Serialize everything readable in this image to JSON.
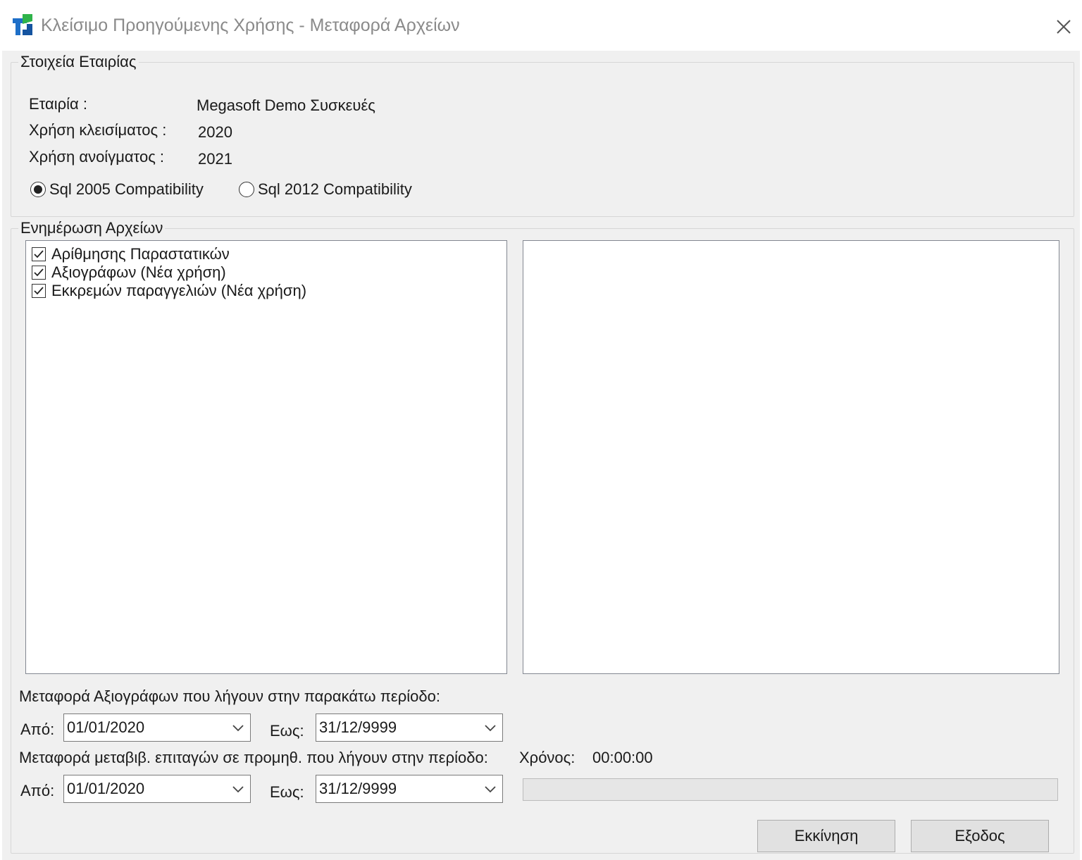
{
  "window": {
    "title": "Κλείσιμο Προηγούμενης Χρήσης - Μεταφορά Αρχείων"
  },
  "company_group": {
    "title": "Στοιχεία Εταιρίας",
    "company_label": "Εταιρία :",
    "company_value": "Megasoft Demo Συσκευές",
    "closing_year_label": "Χρήση κλεισίματος :",
    "closing_year_value": "2020",
    "opening_year_label": "Χρήση ανοίγματος :",
    "opening_year_value": "2021",
    "sql_options": [
      {
        "label": "Sql 2005 Compatibility",
        "selected": true
      },
      {
        "label": "Sql 2012 Compatibility",
        "selected": false
      }
    ]
  },
  "files_group": {
    "title": "Ενημέρωση Αρχείων",
    "items": [
      {
        "label": "Αρίθμησης Παραστατικών",
        "checked": true
      },
      {
        "label": "Αξιογράφων (Νέα χρήση)",
        "checked": true
      },
      {
        "label": "Εκκρεμών παραγγελιών (Νέα χρήση)",
        "checked": true
      }
    ]
  },
  "transfer": {
    "securities_label": "Μεταφορά Αξιογράφων που λήγουν στην παρακάτω περίοδο:",
    "from_label": "Από:",
    "to_label": "Εως:",
    "securities_from": "01/01/2020",
    "securities_to": "31/12/9999",
    "cheques_label": "Μεταφορά μεταβιβ. επιταγών σε προμηθ. που λήγουν στην περίοδο:",
    "cheques_from": "01/01/2020",
    "cheques_to": "31/12/9999",
    "time_label": "Χρόνος:",
    "time_value": "00:00:00",
    "progress": 0
  },
  "buttons": {
    "start": "Εκκίνηση",
    "exit": "Εξοδος"
  },
  "icons": {
    "app": "app-logo-icon",
    "close": "close-icon",
    "dropdown": "chevron-down-icon",
    "check": "checkmark-icon"
  },
  "colors": {
    "window_bg": "#f0f0f0",
    "titlebar_bg": "#ffffff",
    "logo_blue": "#1e6fc8",
    "logo_green": "#2fb34a"
  }
}
